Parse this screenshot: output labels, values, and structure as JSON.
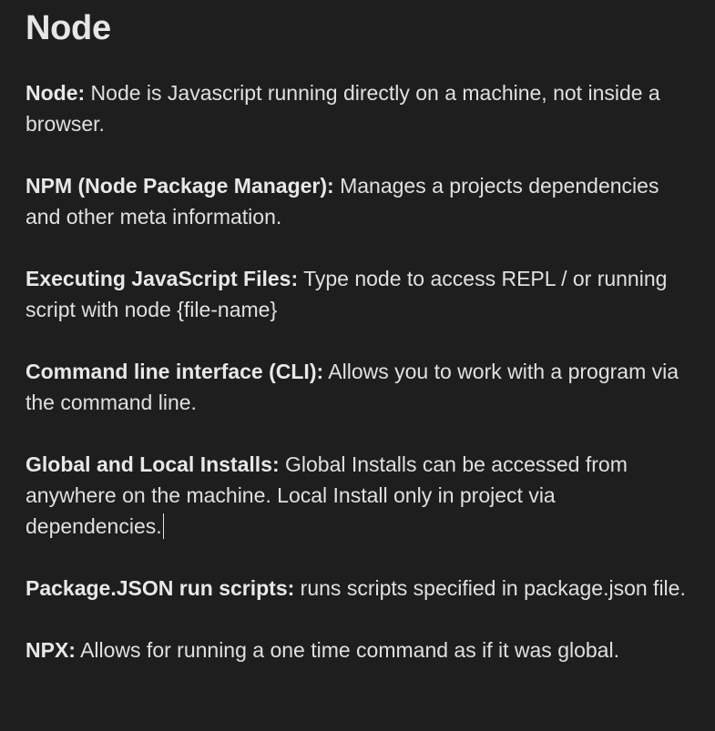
{
  "title": "Node",
  "notes": [
    {
      "term": "Node:",
      "definition": " Node is Javascript running directly on a machine, not inside a browser."
    },
    {
      "term": "NPM (Node Package Manager):",
      "definition": "  Manages a projects dependencies and other meta information."
    },
    {
      "term": "Executing JavaScript Files:",
      "definition": " Type node to access REPL / or running script with node {file-name}"
    },
    {
      "term": "Command line interface (CLI):",
      "definition": " Allows you to work with a program via the command line."
    },
    {
      "term": "Global and Local Installs:",
      "definition": "  Global Installs can be accessed from anywhere on the machine. Local Install only in project via dependencies."
    },
    {
      "term": "Package.JSON run scripts:",
      "definition": " runs scripts specified in package.json file."
    },
    {
      "term": "NPX:",
      "definition": " Allows for running a one time command as if it was global."
    }
  ]
}
